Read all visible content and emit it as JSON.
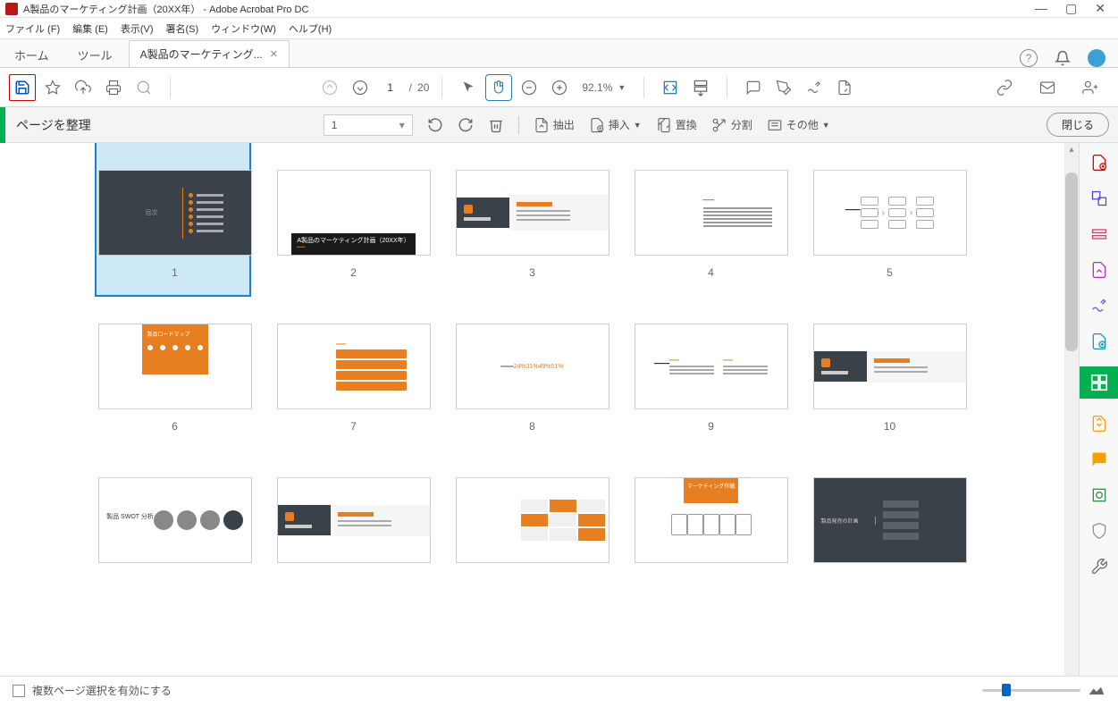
{
  "app": {
    "title": "A製品のマーケティング計画（20XX年） - Adobe Acrobat Pro DC"
  },
  "menu": {
    "file": "ファイル (F)",
    "edit": "編集 (E)",
    "view": "表示(V)",
    "sign": "署名(S)",
    "window": "ウィンドウ(W)",
    "help": "ヘルプ(H)"
  },
  "tabs": {
    "home": "ホーム",
    "tools": "ツール",
    "doc": "A製品のマーケティング..."
  },
  "toolbar": {
    "page_current": "1",
    "page_sep": "/",
    "page_total": "20",
    "zoom": "92.1%"
  },
  "subbar": {
    "title": "ページを整理",
    "page_selector": "1",
    "extract": "抽出",
    "insert": "挿入",
    "replace": "置換",
    "split": "分割",
    "other": "その他",
    "close": "閉じる"
  },
  "pages": {
    "p1": "1",
    "p2": "2",
    "p3": "3",
    "p4": "4",
    "p5": "5",
    "p6": "6",
    "p7": "7",
    "p8": "8",
    "p9": "9",
    "p10": "10"
  },
  "slide2": {
    "caption": "A製品のマーケティング計画（20XX年）"
  },
  "slide8": {
    "pct1": "24%",
    "pct2": "31%",
    "pct3": "49%",
    "pct4": "51%"
  },
  "status": {
    "multi": "複数ページ選択を有効にする"
  }
}
